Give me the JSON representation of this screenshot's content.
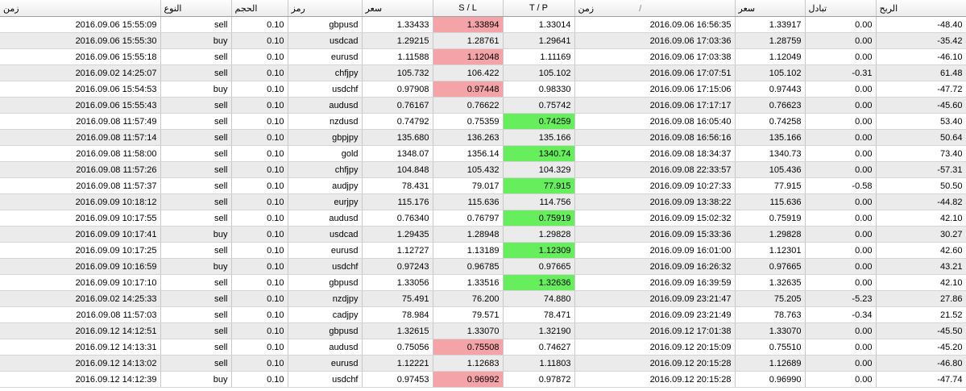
{
  "headers": {
    "time_open": "زمن",
    "type": "النوع",
    "volume": "الحجم",
    "symbol": "رمز",
    "price_open": "سعر",
    "sl": "S / L",
    "tp": "T / P",
    "time_close": "زمن",
    "sort_indicator": "/",
    "price_close": "سعر",
    "swap": "تبادل",
    "profit": "الربح"
  },
  "colors": {
    "loss_hit": "#f4a3a8",
    "profit_hit": "#66ee5c",
    "alt_row": "#ebebeb"
  },
  "rows": [
    {
      "time_open": "2016.09.06 15:55:09",
      "type": "sell",
      "volume": "0.10",
      "symbol": "gbpusd",
      "price_open": "1.33433",
      "sl": "1.33894",
      "tp": "1.33014",
      "time_close": "2016.09.06 16:56:35",
      "price_close": "1.33917",
      "swap": "0.00",
      "profit": "-48.40",
      "hit": "sl"
    },
    {
      "time_open": "2016.09.06 15:55:30",
      "type": "buy",
      "volume": "0.10",
      "symbol": "usdcad",
      "price_open": "1.29215",
      "sl": "1.28761",
      "tp": "1.29641",
      "time_close": "2016.09.06 17:03:36",
      "price_close": "1.28759",
      "swap": "0.00",
      "profit": "-35.42",
      "hit": "sl"
    },
    {
      "time_open": "2016.09.06 15:55:18",
      "type": "sell",
      "volume": "0.10",
      "symbol": "eurusd",
      "price_open": "1.11588",
      "sl": "1.12048",
      "tp": "1.11169",
      "time_close": "2016.09.06 17:03:38",
      "price_close": "1.12049",
      "swap": "0.00",
      "profit": "-46.10",
      "hit": "sl"
    },
    {
      "time_open": "2016.09.02 14:25:07",
      "type": "sell",
      "volume": "0.10",
      "symbol": "chfjpy",
      "price_open": "105.732",
      "sl": "106.422",
      "tp": "105.102",
      "time_close": "2016.09.06 17:07:51",
      "price_close": "105.102",
      "swap": "-0.31",
      "profit": "61.48",
      "hit": "tp"
    },
    {
      "time_open": "2016.09.06 15:54:53",
      "type": "buy",
      "volume": "0.10",
      "symbol": "usdchf",
      "price_open": "0.97908",
      "sl": "0.97448",
      "tp": "0.98330",
      "time_close": "2016.09.06 17:15:06",
      "price_close": "0.97443",
      "swap": "0.00",
      "profit": "-47.72",
      "hit": "sl"
    },
    {
      "time_open": "2016.09.06 15:55:43",
      "type": "sell",
      "volume": "0.10",
      "symbol": "audusd",
      "price_open": "0.76167",
      "sl": "0.76622",
      "tp": "0.75742",
      "time_close": "2016.09.06 17:17:17",
      "price_close": "0.76623",
      "swap": "0.00",
      "profit": "-45.60",
      "hit": "sl"
    },
    {
      "time_open": "2016.09.08 11:57:49",
      "type": "sell",
      "volume": "0.10",
      "symbol": "nzdusd",
      "price_open": "0.74792",
      "sl": "0.75359",
      "tp": "0.74259",
      "time_close": "2016.09.08 16:05:40",
      "price_close": "0.74258",
      "swap": "0.00",
      "profit": "53.40",
      "hit": "tp"
    },
    {
      "time_open": "2016.09.08 11:57:14",
      "type": "sell",
      "volume": "0.10",
      "symbol": "gbpjpy",
      "price_open": "135.680",
      "sl": "136.263",
      "tp": "135.166",
      "time_close": "2016.09.08 16:56:16",
      "price_close": "135.166",
      "swap": "0.00",
      "profit": "50.64",
      "hit": "tp"
    },
    {
      "time_open": "2016.09.08 11:58:00",
      "type": "sell",
      "volume": "0.10",
      "symbol": "gold",
      "price_open": "1348.07",
      "sl": "1356.14",
      "tp": "1340.74",
      "time_close": "2016.09.08 18:34:37",
      "price_close": "1340.73",
      "swap": "0.00",
      "profit": "73.40",
      "hit": "tp"
    },
    {
      "time_open": "2016.09.08 11:57:26",
      "type": "sell",
      "volume": "0.10",
      "symbol": "chfjpy",
      "price_open": "104.848",
      "sl": "105.432",
      "tp": "104.329",
      "time_close": "2016.09.08 22:33:57",
      "price_close": "105.436",
      "swap": "0.00",
      "profit": "-57.31",
      "hit": "sl"
    },
    {
      "time_open": "2016.09.08 11:57:37",
      "type": "sell",
      "volume": "0.10",
      "symbol": "audjpy",
      "price_open": "78.431",
      "sl": "79.017",
      "tp": "77.915",
      "time_close": "2016.09.09 10:27:33",
      "price_close": "77.915",
      "swap": "-0.58",
      "profit": "50.50",
      "hit": "tp"
    },
    {
      "time_open": "2016.09.09 10:18:12",
      "type": "sell",
      "volume": "0.10",
      "symbol": "eurjpy",
      "price_open": "115.176",
      "sl": "115.636",
      "tp": "114.756",
      "time_close": "2016.09.09 13:38:22",
      "price_close": "115.636",
      "swap": "0.00",
      "profit": "-44.82",
      "hit": "sl"
    },
    {
      "time_open": "2016.09.09 10:17:55",
      "type": "sell",
      "volume": "0.10",
      "symbol": "audusd",
      "price_open": "0.76340",
      "sl": "0.76797",
      "tp": "0.75919",
      "time_close": "2016.09.09 15:02:32",
      "price_close": "0.75919",
      "swap": "0.00",
      "profit": "42.10",
      "hit": "tp"
    },
    {
      "time_open": "2016.09.09 10:17:41",
      "type": "buy",
      "volume": "0.10",
      "symbol": "usdcad",
      "price_open": "1.29435",
      "sl": "1.28948",
      "tp": "1.29828",
      "time_close": "2016.09.09 15:33:36",
      "price_close": "1.29828",
      "swap": "0.00",
      "profit": "30.27",
      "hit": "tp"
    },
    {
      "time_open": "2016.09.09 10:17:25",
      "type": "sell",
      "volume": "0.10",
      "symbol": "eurusd",
      "price_open": "1.12727",
      "sl": "1.13189",
      "tp": "1.12309",
      "time_close": "2016.09.09 16:01:00",
      "price_close": "1.12301",
      "swap": "0.00",
      "profit": "42.60",
      "hit": "tp"
    },
    {
      "time_open": "2016.09.09 10:16:59",
      "type": "buy",
      "volume": "0.10",
      "symbol": "usdchf",
      "price_open": "0.97243",
      "sl": "0.96785",
      "tp": "0.97665",
      "time_close": "2016.09.09 16:26:32",
      "price_close": "0.97665",
      "swap": "0.00",
      "profit": "43.21",
      "hit": "tp"
    },
    {
      "time_open": "2016.09.09 10:17:10",
      "type": "sell",
      "volume": "0.10",
      "symbol": "gbpusd",
      "price_open": "1.33056",
      "sl": "1.33516",
      "tp": "1.32636",
      "time_close": "2016.09.09 16:39:59",
      "price_close": "1.32635",
      "swap": "0.00",
      "profit": "42.10",
      "hit": "tp"
    },
    {
      "time_open": "2016.09.02 14:25:33",
      "type": "sell",
      "volume": "0.10",
      "symbol": "nzdjpy",
      "price_open": "75.491",
      "sl": "76.200",
      "tp": "74.880",
      "time_close": "2016.09.09 23:21:47",
      "price_close": "75.205",
      "swap": "-5.23",
      "profit": "27.86",
      "hit": ""
    },
    {
      "time_open": "2016.09.08 11:57:03",
      "type": "sell",
      "volume": "0.10",
      "symbol": "cadjpy",
      "price_open": "78.984",
      "sl": "79.571",
      "tp": "78.471",
      "time_close": "2016.09.09 23:21:49",
      "price_close": "78.763",
      "swap": "-0.34",
      "profit": "21.52",
      "hit": ""
    },
    {
      "time_open": "2016.09.12 14:12:51",
      "type": "sell",
      "volume": "0.10",
      "symbol": "gbpusd",
      "price_open": "1.32615",
      "sl": "1.33070",
      "tp": "1.32190",
      "time_close": "2016.09.12 17:01:38",
      "price_close": "1.33070",
      "swap": "0.00",
      "profit": "-45.50",
      "hit": "sl"
    },
    {
      "time_open": "2016.09.12 14:13:31",
      "type": "sell",
      "volume": "0.10",
      "symbol": "audusd",
      "price_open": "0.75056",
      "sl": "0.75508",
      "tp": "0.74627",
      "time_close": "2016.09.12 20:15:09",
      "price_close": "0.75510",
      "swap": "0.00",
      "profit": "-45.20",
      "hit": "sl"
    },
    {
      "time_open": "2016.09.12 14:13:02",
      "type": "sell",
      "volume": "0.10",
      "symbol": "eurusd",
      "price_open": "1.12221",
      "sl": "1.12683",
      "tp": "1.11803",
      "time_close": "2016.09.12 20:15:28",
      "price_close": "1.12689",
      "swap": "0.00",
      "profit": "-46.80",
      "hit": "sl"
    },
    {
      "time_open": "2016.09.12 14:12:39",
      "type": "buy",
      "volume": "0.10",
      "symbol": "usdchf",
      "price_open": "0.97453",
      "sl": "0.96992",
      "tp": "0.97872",
      "time_close": "2016.09.12 20:15:28",
      "price_close": "0.96990",
      "swap": "0.00",
      "profit": "-47.74",
      "hit": "sl"
    }
  ]
}
